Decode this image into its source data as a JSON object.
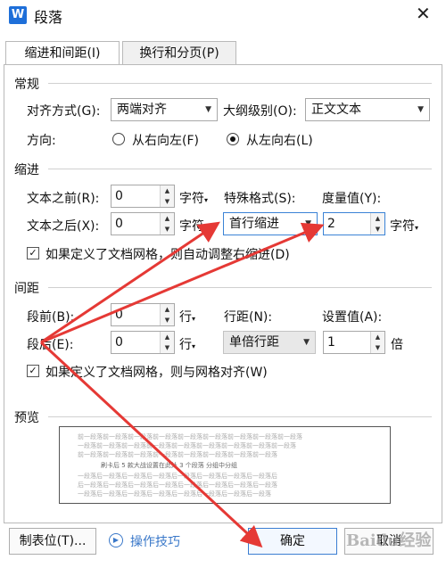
{
  "window": {
    "title": "段落",
    "app_icon_glyph": "W"
  },
  "tabs": [
    {
      "label": "缩进和间距(I)",
      "active": true
    },
    {
      "label": "换行和分页(P)",
      "active": false
    }
  ],
  "general": {
    "title": "常规",
    "align_label": "对齐方式(G):",
    "align_value": "两端对齐",
    "outline_label": "大纲级别(O):",
    "outline_value": "正文文本",
    "direction_label": "方向:",
    "direction_options": [
      "从右向左(F)",
      "从左向右(L)"
    ],
    "direction_selected": "从左向右(L)"
  },
  "indent": {
    "title": "缩进",
    "before_label": "文本之前(R):",
    "before_value": "0",
    "after_label": "文本之后(X):",
    "after_value": "0",
    "unit_char": "字符",
    "special_label": "特殊格式(S):",
    "special_value": "首行缩进",
    "measure_label": "度量值(Y):",
    "measure_value": "2",
    "grid_check_label": "如果定义了文档网格，则自动调整右缩进(D)",
    "grid_checked": true
  },
  "spacing": {
    "title": "间距",
    "before_label": "段前(B):",
    "before_value": "0",
    "after_label": "段后(E):",
    "after_value": "0",
    "unit_line": "行",
    "line_spacing_label": "行距(N):",
    "line_spacing_value": "单倍行距",
    "setting_label": "设置值(A):",
    "setting_value": "1",
    "setting_unit": "倍",
    "grid_check_label": "如果定义了文档网格，则与网格对齐(W)",
    "grid_checked": true
  },
  "preview": {
    "title": "预览",
    "lines": [
      "前一段落前一段落前一段落前一段落前一段落前一段落前一段落前一段落前一段落",
      "一段落前一段落前一段落前一段落前一段落前一段落前一段落前一段落前一段落",
      "前一段落前一段落前一段落前一段落前一段落前一段落前一段落前一段落",
      "刷卡后 5 款大战设置在此处 3 个段落 分组中分组",
      "一段落后一段落后一段落后一段落后一段落后一段落后一段落后一段落后",
      "后一段落后一段落后一段落后一段落后一段落后一段落后一段落后一段落",
      "一段落后一段落后一段落后一段落后一段落后一段落后一段落后一段落"
    ]
  },
  "footer": {
    "tabs_button": "制表位(T)...",
    "tips_label": "操作技巧",
    "ok_button": "确定",
    "cancel_button": "取消"
  },
  "watermark": "Baidu经验",
  "annotation_color": "#e53935"
}
